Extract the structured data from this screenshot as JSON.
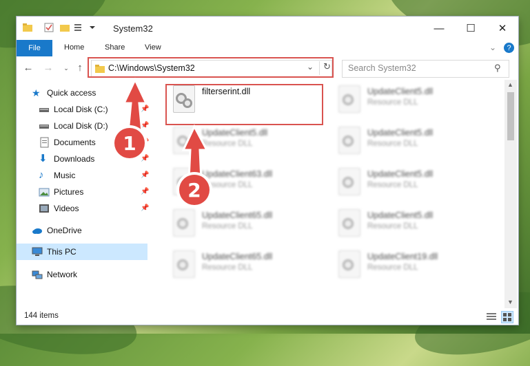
{
  "window": {
    "title": "System32",
    "caption": {
      "minimize": "—",
      "maximize": "☐",
      "close": "✕"
    }
  },
  "ribbon": {
    "tabs": [
      "File",
      "Home",
      "Share",
      "View"
    ],
    "collapse_icon": "chevron-down-icon",
    "help_icon": "help-icon"
  },
  "address_bar": {
    "path": "C:\\Windows\\System32",
    "search_placeholder": "Search System32"
  },
  "sidebar": {
    "quick_access": "Quick access",
    "items": [
      {
        "label": "Local Disk (C:)",
        "icon": "drive-icon",
        "pinned": true
      },
      {
        "label": "Local Disk (D:)",
        "icon": "drive-icon",
        "pinned": true
      },
      {
        "label": "Documents",
        "icon": "documents-icon",
        "pinned": true
      },
      {
        "label": "Downloads",
        "icon": "downloads-icon",
        "pinned": true
      },
      {
        "label": "Music",
        "icon": "music-icon",
        "pinned": true
      },
      {
        "label": "Pictures",
        "icon": "pictures-icon",
        "pinned": true
      },
      {
        "label": "Videos",
        "icon": "videos-icon",
        "pinned": true
      }
    ],
    "onedrive": "OneDrive",
    "this_pc": "This PC",
    "network": "Network"
  },
  "files": [
    {
      "name": "filterserint.dll",
      "type": "",
      "blurred": false
    },
    {
      "name": "UpdateClient5.dll",
      "type": "Resource DLL",
      "blurred": true
    },
    {
      "name": "UpdateClient5.dll",
      "type": "Resource DLL",
      "blurred": true
    },
    {
      "name": "UpdateClient5.dll",
      "type": "Resource DLL",
      "blurred": true
    },
    {
      "name": "UpdateClient63.dll",
      "type": "Resource DLL",
      "blurred": true
    },
    {
      "name": "UpdateClient5.dll",
      "type": "Resource DLL",
      "blurred": true
    },
    {
      "name": "UpdateClient65.dll",
      "type": "Resource DLL",
      "blurred": true
    },
    {
      "name": "UpdateClient5.dll",
      "type": "Resource DLL",
      "blurred": true
    },
    {
      "name": "UpdateClient65.dll",
      "type": "Resource DLL",
      "blurred": true
    },
    {
      "name": "UpdateClient19.dll",
      "type": "Resource DLL",
      "blurred": true
    }
  ],
  "status": {
    "item_count": "144 items"
  },
  "annotations": {
    "step1": "1",
    "step2": "2",
    "highlight_color": "#d9534f"
  },
  "colors": {
    "accent": "#1979ca",
    "selection": "#cce8ff"
  }
}
